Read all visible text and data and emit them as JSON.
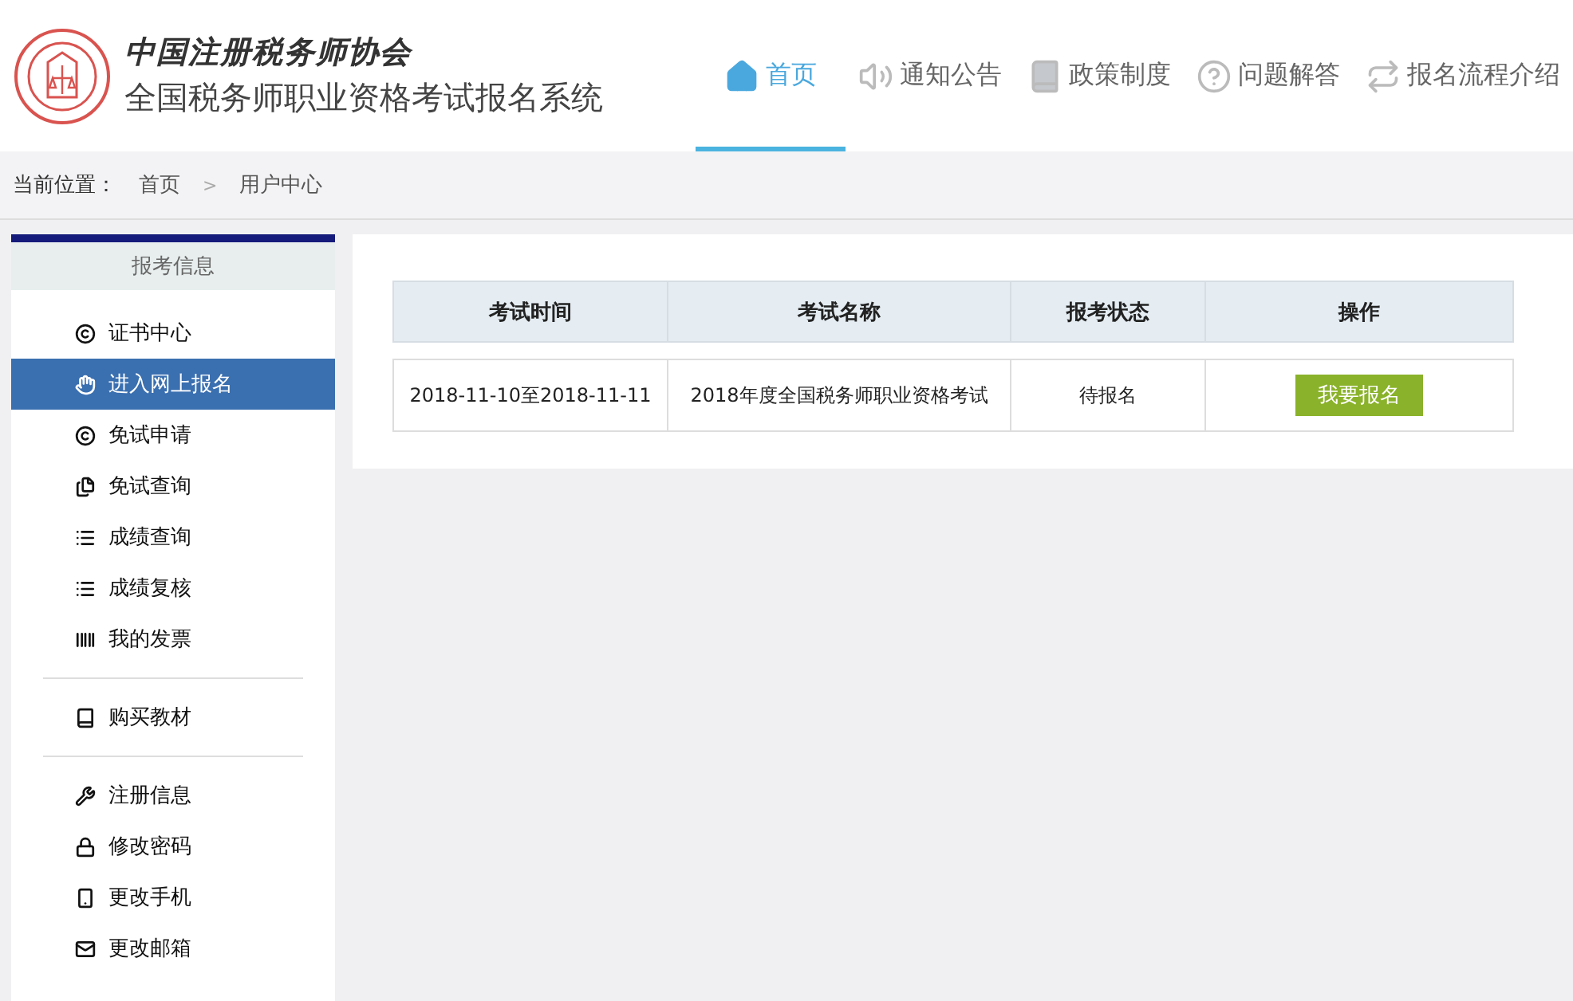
{
  "logo": {
    "calligraphy": "中国注册税务师协会",
    "title": "全国税务师职业资格考试报名系统"
  },
  "nav": [
    {
      "label": "首页",
      "selected": true
    },
    {
      "label": "通知公告",
      "selected": false
    },
    {
      "label": "政策制度",
      "selected": false
    },
    {
      "label": "问题解答",
      "selected": false
    },
    {
      "label": "报名流程介绍",
      "selected": false
    }
  ],
  "breadcrumb": {
    "label": "当前位置：",
    "items": [
      "首页",
      "用户中心"
    ],
    "separator": ">"
  },
  "sidebar": {
    "title": "报考信息",
    "groups": [
      [
        {
          "label": "证书中心",
          "selected": false
        },
        {
          "label": "进入网上报名",
          "selected": true
        },
        {
          "label": "免试申请",
          "selected": false
        },
        {
          "label": "免试查询",
          "selected": false
        },
        {
          "label": "成绩查询",
          "selected": false
        },
        {
          "label": "成绩复核",
          "selected": false
        },
        {
          "label": "我的发票",
          "selected": false
        }
      ],
      [
        {
          "label": "购买教材",
          "selected": false
        }
      ],
      [
        {
          "label": "注册信息",
          "selected": false
        },
        {
          "label": "修改密码",
          "selected": false
        },
        {
          "label": "更改手机",
          "selected": false
        },
        {
          "label": "更改邮箱",
          "selected": false
        }
      ]
    ]
  },
  "table": {
    "columns": [
      "考试时间",
      "考试名称",
      "报考状态",
      "操作"
    ],
    "rows": [
      {
        "time": "2018-11-10至2018-11-11",
        "name": "2018年度全国税务师职业资格考试",
        "status": "待报名",
        "action": "我要报名"
      }
    ]
  }
}
